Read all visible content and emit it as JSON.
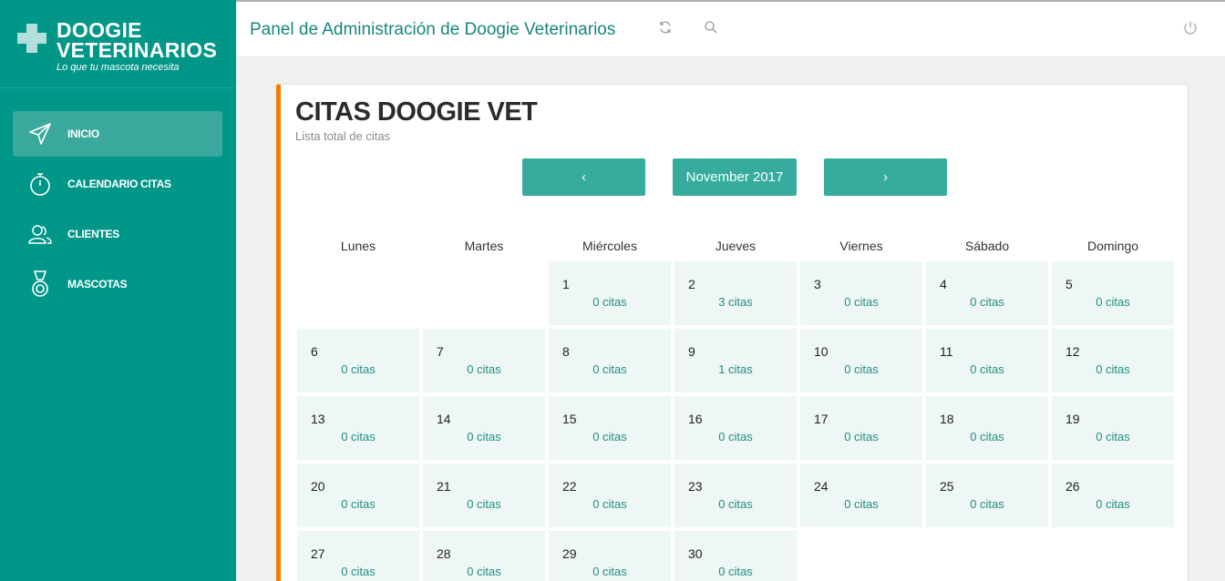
{
  "brand": {
    "line1": "DOOGIE",
    "line2": "VETERINARIOS",
    "tagline": "Lo que tu mascota necesita"
  },
  "nav": [
    {
      "label": "INICIO",
      "icon": "send-icon",
      "active": true
    },
    {
      "label": "CALENDARIO CITAS",
      "icon": "stopwatch-icon",
      "active": false
    },
    {
      "label": "CLIENTES",
      "icon": "users-icon",
      "active": false
    },
    {
      "label": "MASCOTAS",
      "icon": "medal-icon",
      "active": false
    }
  ],
  "topbar": {
    "title": "Panel de Administración de Doogie Veterinarios",
    "icons": [
      "refresh-icon",
      "search-icon",
      "power-icon"
    ]
  },
  "card": {
    "title": "CITAS DOOGIE VET",
    "subtitle": "Lista total de citas"
  },
  "calendar": {
    "prev_label": "‹",
    "month_label": "November 2017",
    "next_label": "›",
    "weekdays": [
      "Lunes",
      "Martes",
      "Miércoles",
      "Jueves",
      "Viernes",
      "Sábado",
      "Domingo"
    ],
    "leading_blanks": 2,
    "days": [
      {
        "n": "1",
        "c": "0 citas"
      },
      {
        "n": "2",
        "c": "3 citas"
      },
      {
        "n": "3",
        "c": "0 citas"
      },
      {
        "n": "4",
        "c": "0 citas"
      },
      {
        "n": "5",
        "c": "0 citas"
      },
      {
        "n": "6",
        "c": "0 citas"
      },
      {
        "n": "7",
        "c": "0 citas"
      },
      {
        "n": "8",
        "c": "0 citas"
      },
      {
        "n": "9",
        "c": "1 citas"
      },
      {
        "n": "10",
        "c": "0 citas"
      },
      {
        "n": "11",
        "c": "0 citas"
      },
      {
        "n": "12",
        "c": "0 citas"
      },
      {
        "n": "13",
        "c": "0 citas"
      },
      {
        "n": "14",
        "c": "0 citas"
      },
      {
        "n": "15",
        "c": "0 citas"
      },
      {
        "n": "16",
        "c": "0 citas"
      },
      {
        "n": "17",
        "c": "0 citas"
      },
      {
        "n": "18",
        "c": "0 citas"
      },
      {
        "n": "19",
        "c": "0 citas"
      },
      {
        "n": "20",
        "c": "0 citas"
      },
      {
        "n": "21",
        "c": "0 citas"
      },
      {
        "n": "22",
        "c": "0 citas"
      },
      {
        "n": "23",
        "c": "0 citas"
      },
      {
        "n": "24",
        "c": "0 citas"
      },
      {
        "n": "25",
        "c": "0 citas"
      },
      {
        "n": "26",
        "c": "0 citas"
      },
      {
        "n": "27",
        "c": "0 citas"
      },
      {
        "n": "28",
        "c": "0 citas"
      },
      {
        "n": "29",
        "c": "0 citas"
      },
      {
        "n": "30",
        "c": "0 citas"
      }
    ]
  },
  "colors": {
    "primary": "#009688",
    "accent": "#f57c00",
    "button": "#36ac9f",
    "cell": "#eef7f5"
  }
}
